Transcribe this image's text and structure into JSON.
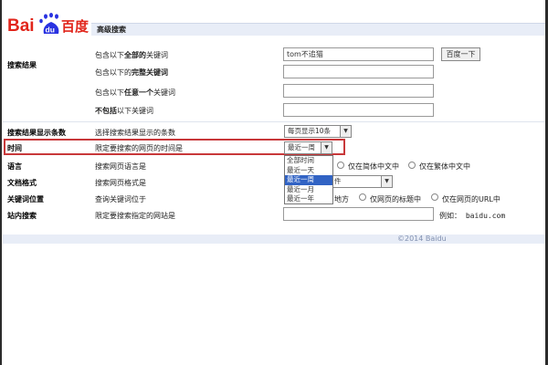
{
  "logo": {
    "left": "Bai",
    "paw_text": "du",
    "right": "百度"
  },
  "header": {
    "title": "高级搜索"
  },
  "search_results": {
    "section_label": "搜索结果",
    "rows": [
      {
        "prefix": "包含以下",
        "bold": "全部的",
        "suffix": "关键词",
        "value": "tom不追猫"
      },
      {
        "prefix": "包含以下的",
        "bold": "完整关键词",
        "suffix": "",
        "value": ""
      },
      {
        "prefix": "包含以下",
        "bold": "任意一个",
        "suffix": "关键词",
        "value": ""
      },
      {
        "prefix": "",
        "bold": "不包括",
        "suffix": "以下关键词",
        "value": ""
      }
    ],
    "search_button": "百度一下"
  },
  "display_count": {
    "label": "搜索结果显示条数",
    "desc": "选择搜索结果显示的条数",
    "selected": "每页显示10条"
  },
  "time": {
    "label": "时间",
    "desc": "限定要搜索的网页的时间是",
    "selected": "最近一周",
    "options": [
      "全部时间",
      "最近一天",
      "最近一周",
      "最近一月",
      "最近一年"
    ],
    "highlighted_index": 2
  },
  "language": {
    "label": "语言",
    "desc": "搜索网页语言是",
    "opt_simplified": "仅在简体中文中",
    "opt_traditional": "仅在繁体中文中"
  },
  "doc_format": {
    "label": "文档格式",
    "desc": "搜索网页格式是",
    "selected": "件"
  },
  "keyword_position": {
    "label": "关键词位置",
    "desc": "查询关键词位于",
    "opt_anywhere": "地方",
    "opt_title": "仅网页的标题中",
    "opt_url": "仅在网页的URL中"
  },
  "site_search": {
    "label": "站内搜索",
    "desc": "限定要搜索指定的网站是",
    "example": "例如： baidu.com"
  },
  "footer": {
    "copyright": "©2014 Baidu"
  },
  "colors": {
    "logo_red": "#e1251b",
    "logo_blue": "#2932e1",
    "highlight": "#c8383a",
    "selected_option": "#3163c4"
  }
}
